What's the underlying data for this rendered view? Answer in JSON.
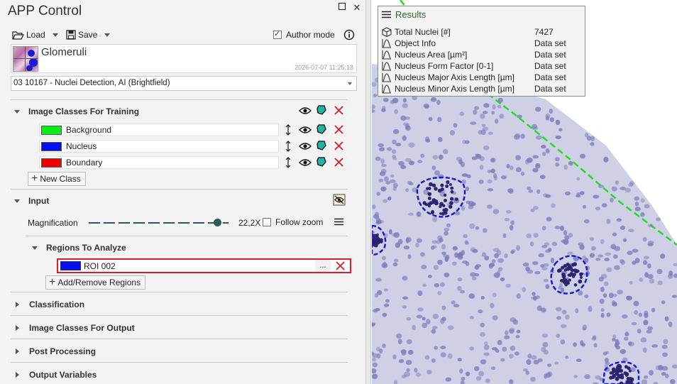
{
  "panel": {
    "title": "APP Control",
    "window_buttons": {
      "restore_icon": "square-icon",
      "close_label": "✕"
    },
    "toolbar": {
      "load_label": "Load",
      "save_label": "Save",
      "author_mode_label": "Author mode",
      "author_mode_checked": true
    },
    "app": {
      "name": "Glomeruli",
      "date": "2026-07-07 11:25:18",
      "selected": "03 10167 - Nuclei Detection, AI (Brightfield)"
    },
    "training": {
      "header": "Image Classes For Training",
      "classes": [
        {
          "label": "Background",
          "color": "#00ef14"
        },
        {
          "label": "Nucleus",
          "color": "#0010ef"
        },
        {
          "label": "Boundary",
          "color": "#ef0000"
        }
      ],
      "new_class_label": "New Class"
    },
    "input": {
      "header": "Input",
      "magnification_label": "Magnification",
      "magnification_value": "22,2X",
      "follow_zoom_label": "Follow zoom",
      "follow_zoom_checked": false
    },
    "regions": {
      "header": "Regions To Analyze",
      "roi_label": "ROI 002",
      "roi_color": "#0010ef",
      "roi_more_label": "...",
      "add_remove_label": "Add/Remove Regions"
    },
    "sections": {
      "classification": "Classification",
      "classes_output": "Image Classes For Output",
      "post_processing": "Post Processing",
      "output_variables": "Output Variables"
    }
  },
  "results": {
    "title": "Results",
    "rows": [
      {
        "icon": "cube-icon",
        "name": "Total Nuclei [#]",
        "value": "7427"
      },
      {
        "icon": "bell-curve-icon",
        "name": "Object Info",
        "value": "Data set"
      },
      {
        "icon": "bell-curve-icon",
        "name": "Nucleus Area [µm²]",
        "value": "Data set"
      },
      {
        "icon": "bell-curve-icon",
        "name": "Nucleus Form Factor [0-1]",
        "value": "Data set"
      },
      {
        "icon": "bell-curve-icon",
        "name": "Nucleus Major Axis Length [µm]",
        "value": "Data set"
      },
      {
        "icon": "bell-curve-icon",
        "name": "Nucleus Minor Axis Length [µm]",
        "value": "Data set"
      }
    ]
  },
  "colors": {
    "accent_teal": "#2a5b5b",
    "delete_red": "#d81e2a",
    "roi_outline_green": "#22dd22",
    "glomeruli_outline_blue": "#1a1ad0",
    "tissue": "#cfd0e6",
    "nucleus": "#7a7ab8"
  }
}
